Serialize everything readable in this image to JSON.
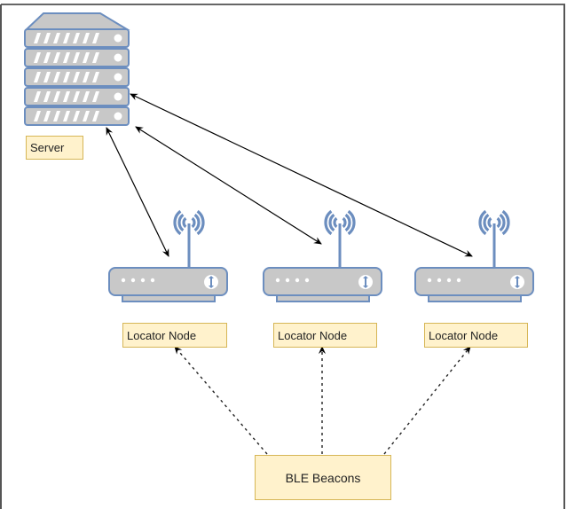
{
  "diagram": {
    "type": "network-architecture",
    "nodes": {
      "server": {
        "label": "Server",
        "icon": "server-rack-icon"
      },
      "locators": [
        {
          "label": "Locator Node",
          "icon": "wifi-router-icon"
        },
        {
          "label": "Locator Node",
          "icon": "wifi-router-icon"
        },
        {
          "label": "Locator Node",
          "icon": "wifi-router-icon"
        }
      ],
      "beacons": {
        "label": "BLE Beacons"
      }
    },
    "edges": [
      {
        "from": "server",
        "to": "locator-1",
        "style": "solid",
        "direction": "both"
      },
      {
        "from": "server",
        "to": "locator-2",
        "style": "solid",
        "direction": "both"
      },
      {
        "from": "server",
        "to": "locator-3",
        "style": "solid",
        "direction": "both"
      },
      {
        "from": "beacons",
        "to": "locator-1",
        "style": "dashed",
        "direction": "forward"
      },
      {
        "from": "beacons",
        "to": "locator-2",
        "style": "dashed",
        "direction": "forward"
      },
      {
        "from": "beacons",
        "to": "locator-3",
        "style": "dashed",
        "direction": "forward"
      }
    ],
    "colors": {
      "icon_stroke": "#6c8ebf",
      "icon_fill": "#c8c8c8",
      "label_fill": "#fff2cc",
      "label_stroke": "#d6b656"
    }
  }
}
